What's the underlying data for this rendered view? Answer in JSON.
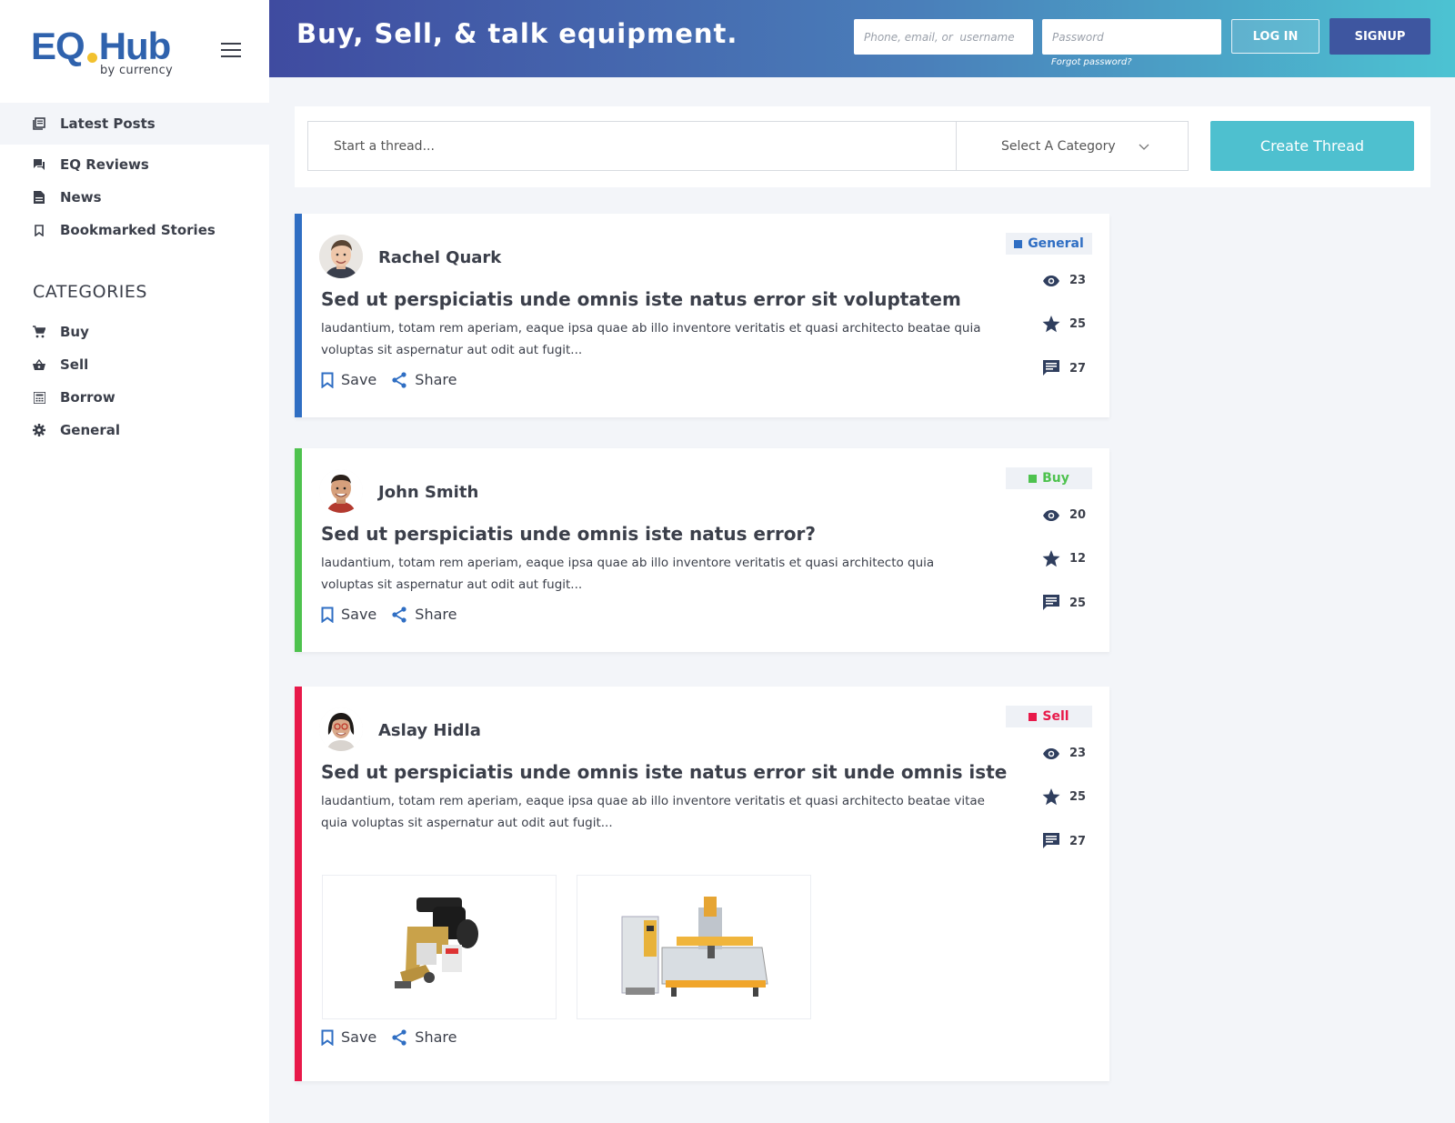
{
  "brand": {
    "eq": "EQ",
    "hub": "Hub",
    "sub": "by currency"
  },
  "sidebar": {
    "nav": [
      {
        "label": "Latest Posts",
        "icon": "newspaper-icon"
      },
      {
        "label": "EQ Reviews",
        "icon": "chat-icon"
      },
      {
        "label": "News",
        "icon": "document-icon"
      },
      {
        "label": "Bookmarked Stories",
        "icon": "bookmark-icon"
      }
    ],
    "categories_title": "CATEGORIES",
    "categories": [
      {
        "label": "Buy",
        "icon": "cart-icon"
      },
      {
        "label": "Sell",
        "icon": "basket-icon"
      },
      {
        "label": "Borrow",
        "icon": "calculator-icon"
      },
      {
        "label": "General",
        "icon": "gear-icon"
      }
    ]
  },
  "header": {
    "tagline": "Buy, Sell, & talk equipment.",
    "phone_placeholder": "Phone, email, or  username",
    "password_placeholder": "Password",
    "forgot": "Forgot password?",
    "login": "LOG IN",
    "signup": "SIGNUP"
  },
  "creator": {
    "placeholder": "Start a thread...",
    "category": "Select A Category",
    "create": "Create Thread"
  },
  "colors": {
    "general": "#2f6ec3",
    "buy": "#4ec24e",
    "sell": "#e8194a",
    "accent": "#4ec0cf"
  },
  "posts": [
    {
      "author": "Rachel Quark",
      "category": "General",
      "title": "Sed ut perspiciatis unde omnis iste natus error sit voluptatem",
      "excerpt": "laudantium, totam rem aperiam, eaque ipsa quae ab illo inventore veritatis et quasi architecto beatae quia voluptas sit aspernatur aut odit aut fugit...",
      "views": "23",
      "stars": "25",
      "comments": "27",
      "save": "Save",
      "share": "Share"
    },
    {
      "author": "John Smith",
      "category": "Buy",
      "title": "Sed ut perspiciatis unde omnis iste natus error?",
      "excerpt": "laudantium, totam rem aperiam, eaque ipsa quae ab illo inventore veritatis et quasi architecto quia voluptas sit aspernatur aut odit aut fugit...",
      "views": "20",
      "stars": "12",
      "comments": "25",
      "save": "Save",
      "share": "Share"
    },
    {
      "author": "Aslay Hidla",
      "category": "Sell",
      "title": "Sed ut perspiciatis unde omnis iste natus error sit unde omnis iste",
      "excerpt": "laudantium, totam rem aperiam, eaque ipsa quae ab illo inventore veritatis et quasi architecto beatae vitae quia voluptas sit aspernatur aut odit aut fugit...",
      "views": "23",
      "stars": "25",
      "comments": "27",
      "save": "Save",
      "share": "Share"
    }
  ]
}
